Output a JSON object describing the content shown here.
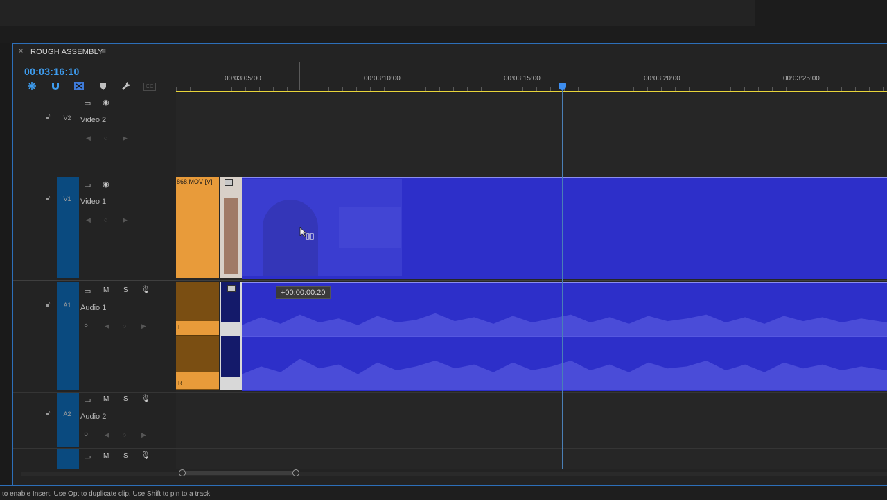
{
  "sequence": {
    "tab_close": "×",
    "tab_title": "ROUGH ASSEMBLY",
    "tab_menu": "≡",
    "timecode": "00:03:16:10"
  },
  "toolbar": {
    "tools": [
      "snap-insert-icon",
      "magnet-icon",
      "linked-selection-icon",
      "marker-icon",
      "wrench-icon",
      "captions-icon"
    ],
    "captions_label": "CC"
  },
  "ruler": {
    "ticks": [
      "00:03:05:00",
      "00:03:10:00",
      "00:03:15:00",
      "00:03:20:00",
      "00:03:25:00"
    ]
  },
  "tracks": {
    "v2": {
      "id": "V2",
      "name": "Video 2"
    },
    "v1": {
      "id": "V1",
      "name": "Video 1"
    },
    "a1": {
      "id": "A1",
      "name": "Audio 1",
      "mute": "M",
      "solo": "S"
    },
    "a2": {
      "id": "A2",
      "name": "Audio 2",
      "mute": "M",
      "solo": "S"
    },
    "a3": {
      "mute": "M",
      "solo": "S"
    }
  },
  "clips": {
    "video_orange_label": "868.MOV [V]",
    "audio_left_channel": "L",
    "audio_right_channel": "R"
  },
  "drag": {
    "offset": "+00:00:00:20"
  },
  "colors": {
    "accent": "#3e9df0",
    "selected_clip": "#2d2fc9",
    "video_clip": "#e89b3a",
    "audio_clip": "#7a4e12",
    "track_tab": "#0a4a7f"
  },
  "status_bar": {
    "hint": "to enable Insert. Use Opt to duplicate clip. Use Shift to pin to a track."
  }
}
